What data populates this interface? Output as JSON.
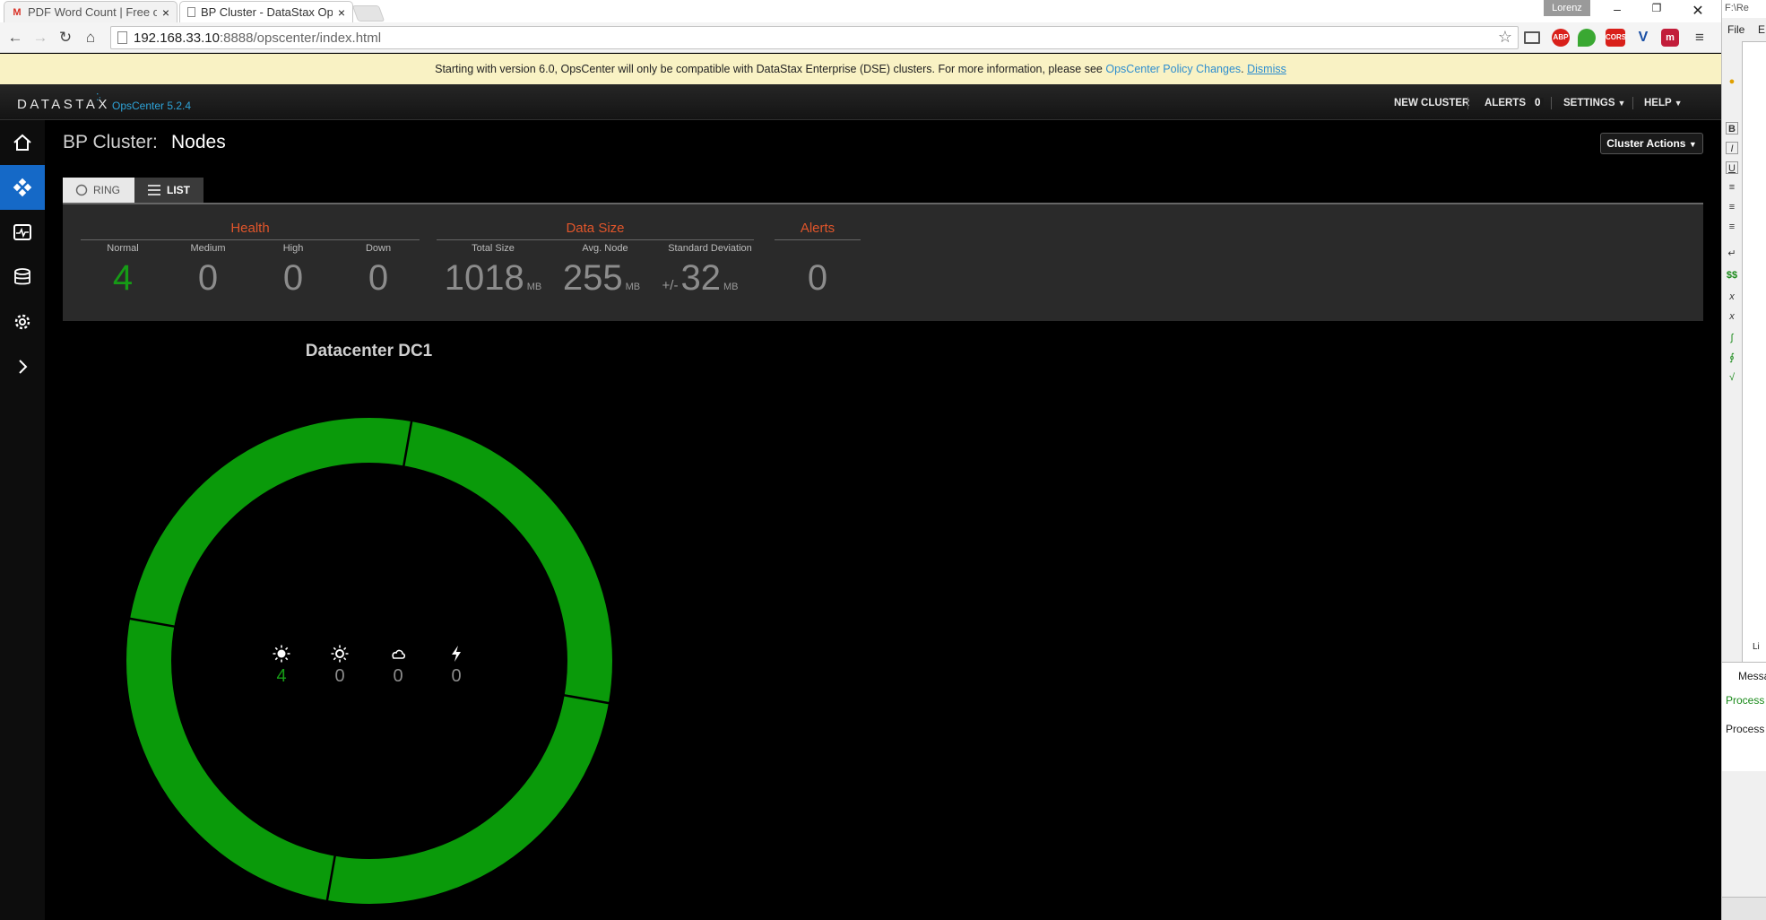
{
  "browser": {
    "tabs": [
      {
        "label": "PDF Word Count | Free on",
        "favicon": "gmail-icon",
        "active": false
      },
      {
        "label": "BP Cluster - DataStax Ops",
        "favicon": "page-icon",
        "active": true
      }
    ],
    "profile_name": "Lorenz",
    "url_host": "192.168.33.10",
    "url_path": ":8888/opscenter/index.html",
    "extensions": [
      "ABP",
      "CORS"
    ]
  },
  "banner": {
    "text": "Starting with version 6.0, OpsCenter will only be compatible with DataStax Enterprise (DSE) clusters. For more information, please see",
    "link_label": "OpsCenter Policy Changes",
    "dismiss_label": "Dismiss"
  },
  "header": {
    "logo_text": "DATASTAX",
    "version": "OpsCenter 5.2.4",
    "nav": {
      "new_cluster": "NEW CLUSTER",
      "alerts": "ALERTS",
      "alerts_count": "0",
      "settings": "SETTINGS",
      "help": "HELP"
    }
  },
  "sidebar": {
    "items": [
      {
        "name": "home-icon",
        "active": false
      },
      {
        "name": "nodes-icon",
        "active": true
      },
      {
        "name": "dashboard-icon",
        "active": false
      },
      {
        "name": "database-icon",
        "active": false
      },
      {
        "name": "gear-icon",
        "active": false
      },
      {
        "name": "chevron-right-icon",
        "active": false
      }
    ]
  },
  "page": {
    "title_prefix": "BP Cluster:",
    "title": "Nodes",
    "cluster_actions": "Cluster Actions"
  },
  "view_tabs": {
    "ring": "RING",
    "list": "LIST",
    "active": "list"
  },
  "stats": {
    "health": {
      "title": "Health",
      "normal_label": "Normal",
      "normal": "4",
      "medium_label": "Medium",
      "medium": "0",
      "high_label": "High",
      "high": "0",
      "down_label": "Down",
      "down": "0"
    },
    "data_size": {
      "title": "Data Size",
      "total_label": "Total Size",
      "total": "1018",
      "total_unit": "MB",
      "avg_label": "Avg. Node",
      "avg": "255",
      "avg_unit": "MB",
      "std_label": "Standard Deviation",
      "std_prefix": "+/-",
      "std": "32",
      "std_unit": "MB"
    },
    "alerts": {
      "title": "Alerts",
      "value": "0"
    }
  },
  "datacenter": {
    "title": "Datacenter DC1",
    "ring_color": "#0a9a0a",
    "node_count": 4,
    "health_counts": [
      {
        "icon": "sun-icon",
        "value": "4"
      },
      {
        "icon": "sun-outline-icon",
        "value": "0"
      },
      {
        "icon": "cloud-icon",
        "value": "0"
      },
      {
        "icon": "lightning-icon",
        "value": "0"
      }
    ]
  },
  "right_app": {
    "path": "F:\\Re",
    "menu_file": "File",
    "menu_e": "E",
    "status_label": "Li",
    "messages_tab": "Messa",
    "lines": [
      "Process",
      "Process"
    ]
  },
  "colors": {
    "accent_blue": "#1569c7",
    "health_green": "#169b16",
    "group_title_orange": "#e0552a",
    "banner_bg": "#f9f2c4"
  }
}
